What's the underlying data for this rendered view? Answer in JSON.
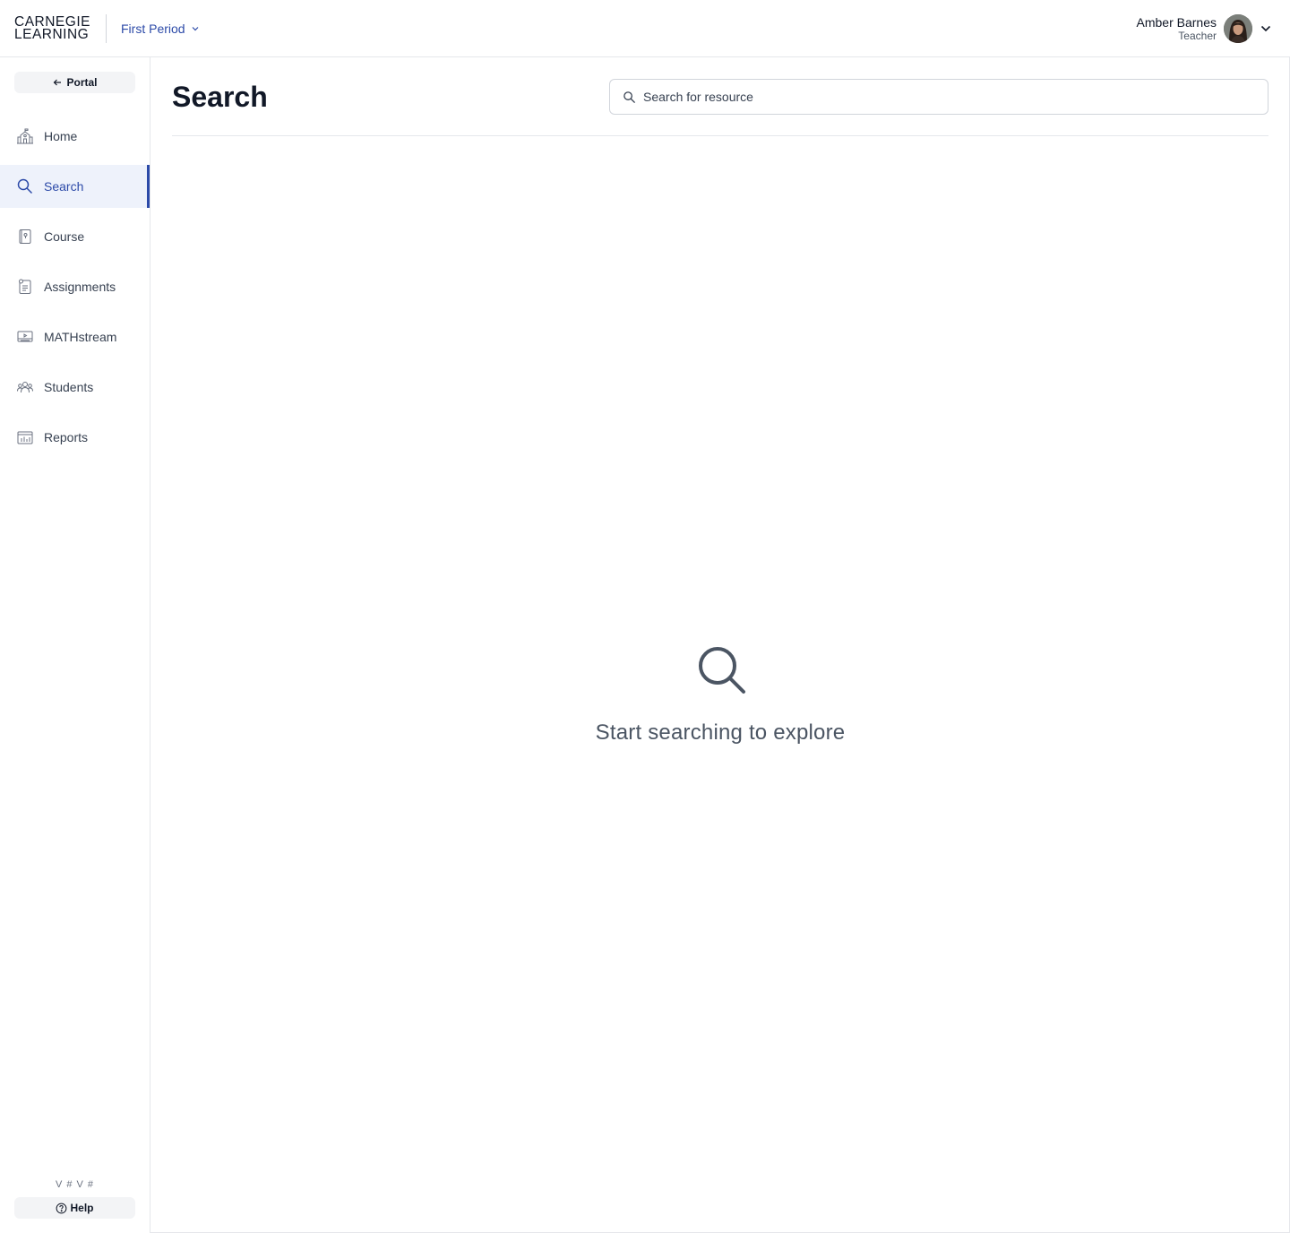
{
  "header": {
    "logo": {
      "line1": "CARNEGIE",
      "line2": "LEARNING"
    },
    "class_selector": "First Period",
    "user": {
      "name": "Amber Barnes",
      "role": "Teacher"
    }
  },
  "sidebar": {
    "portal_label": "Portal",
    "items": [
      {
        "label": "Home",
        "icon": "school-icon"
      },
      {
        "label": "Search",
        "icon": "search-icon",
        "active": true
      },
      {
        "label": "Course",
        "icon": "book-icon"
      },
      {
        "label": "Assignments",
        "icon": "assignment-icon"
      },
      {
        "label": "MATHstream",
        "icon": "video-icon"
      },
      {
        "label": "Students",
        "icon": "students-icon"
      },
      {
        "label": "Reports",
        "icon": "reports-icon"
      }
    ],
    "version": "V #   V #",
    "help_label": "Help"
  },
  "main": {
    "title": "Search",
    "search_placeholder": "Search for resource",
    "empty_message": "Start searching to explore"
  },
  "colors": {
    "accent": "#2c4aa8",
    "active_bg": "#eef2fb",
    "border": "#e5e7eb"
  }
}
